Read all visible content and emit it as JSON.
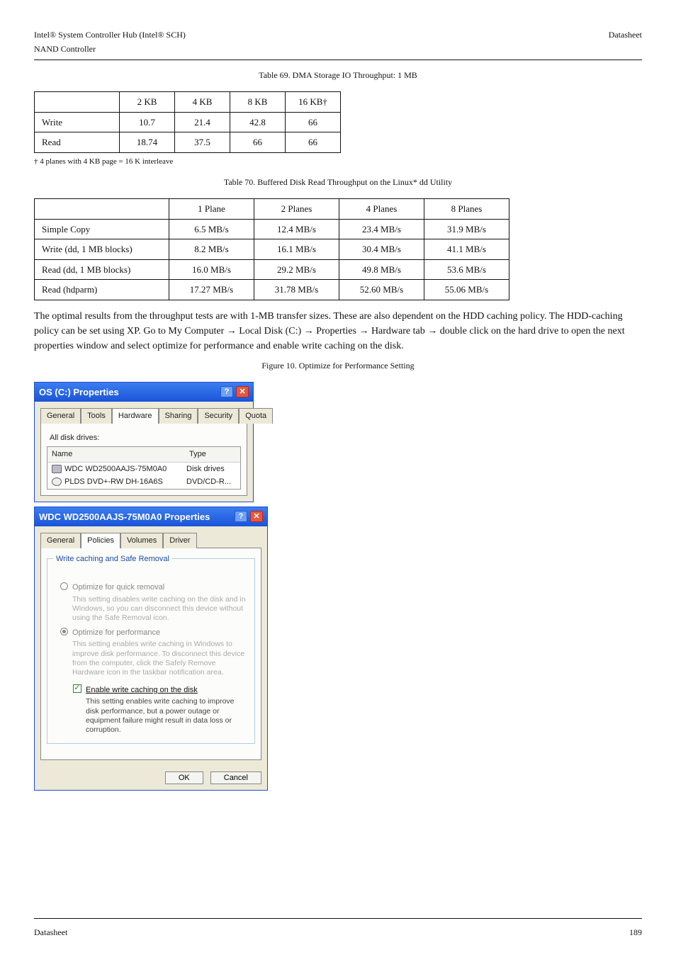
{
  "header": {
    "left": "Intel® System Controller Hub (Intel® SCH)",
    "right": "Datasheet",
    "sectionPath": "NAND Controller"
  },
  "footer": {
    "left": "Datasheet",
    "right": "189"
  },
  "captions": {
    "t1": "Table 69.   DMA Storage IO Throughput: 1 MB",
    "t2": "Table 70.   Buffered Disk Read Throughput on the Linux* dd Utility",
    "fig": "Figure 10.   Optimize for Performance Setting"
  },
  "text": {
    "note": "† 4 planes with 4 KB page = 16 K interleave",
    "p1": "The optimal results from the throughput tests are with 1-MB transfer sizes. These are also dependent on the HDD caching policy. The HDD-caching policy can be set using XP. Go to My Computer → Local Disk (C:) → Properties → Hardware tab → double click on the hard drive to open the next properties window and select optimize for performance and enable write caching on the disk."
  },
  "table1": {
    "rows": [
      [
        "",
        "2 KB",
        "4 KB",
        "8 KB",
        "16 KB†"
      ],
      [
        "Write",
        "10.7",
        "21.4",
        "42.8",
        "66"
      ],
      [
        "Read",
        "18.74",
        "37.5",
        "66",
        "66"
      ]
    ]
  },
  "table2": {
    "rows": [
      [
        "",
        "1 Plane",
        "2 Planes",
        "4 Planes",
        "8 Planes"
      ],
      [
        "Simple Copy",
        "6.5 MB/s",
        "12.4 MB/s",
        "23.4 MB/s",
        "31.9 MB/s"
      ],
      [
        "Write (dd, 1 MB blocks)",
        "8.2 MB/s",
        "16.1 MB/s",
        "30.4 MB/s",
        "41.1 MB/s"
      ],
      [
        "Read (dd, 1 MB blocks)",
        "16.0 MB/s",
        "29.2 MB/s",
        "49.8 MB/s",
        "53.6 MB/s"
      ],
      [
        "Read (hdparm)",
        "17.27 MB/s",
        "31.78 MB/s",
        "52.60 MB/s",
        "55.06 MB/s"
      ]
    ]
  },
  "win1": {
    "title": "OS (C:) Properties",
    "tabs": [
      "General",
      "Tools",
      "Hardware",
      "Sharing",
      "Security",
      "Quota"
    ],
    "activeTab": "Hardware",
    "drivesLabel": "All disk drives:",
    "cols": [
      "Name",
      "Type"
    ],
    "rows": [
      {
        "name": "WDC WD2500AAJS-75M0A0",
        "type": "Disk drives"
      },
      {
        "name": "PLDS DVD+-RW DH-16A6S",
        "type": "DVD/CD-R..."
      }
    ]
  },
  "win2": {
    "title": "WDC WD2500AAJS-75M0A0 Properties",
    "tabs": [
      "General",
      "Policies",
      "Volumes",
      "Driver"
    ],
    "activeTab": "Policies",
    "group": "Write caching and Safe Removal",
    "opt1": {
      "label": "Optimize for quick removal",
      "desc": "This setting disables write caching on the disk and in Windows, so you can disconnect this device without using the Safe Removal icon."
    },
    "opt2": {
      "label": "Optimize for performance",
      "desc": "This setting enables write caching in Windows to improve disk performance. To disconnect this device from the computer, click the Safely Remove Hardware icon in the taskbar notification area."
    },
    "chk": {
      "label": "Enable write caching on the disk",
      "desc": "This setting enables write caching to improve disk performance, but a power outage or equipment failure might result in data loss or corruption."
    },
    "ok": "OK",
    "cancel": "Cancel"
  }
}
